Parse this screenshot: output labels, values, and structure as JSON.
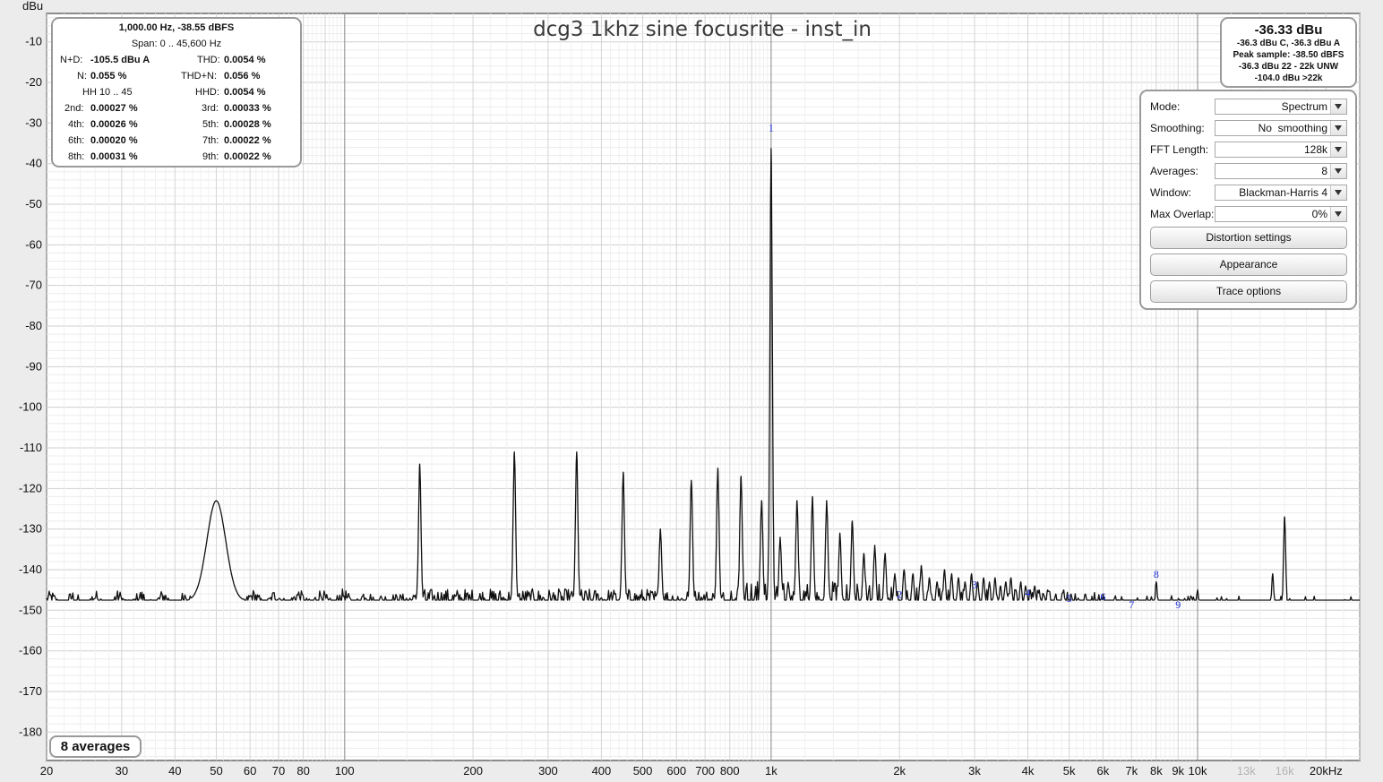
{
  "title": "dcg3 1khz sine focusrite - inst_in",
  "y_unit_label": "dBu",
  "stats": {
    "line1": "1,000.00 Hz, -38.55 dBFS",
    "line2": "Span: 0 .. 45,600 Hz",
    "nd_label": "N+D:",
    "nd_value": "-105.5 dBu A",
    "thd_label": "THD:",
    "thd_value": "0.0054 %",
    "n_label": "N:",
    "n_value": "0.055 %",
    "thdn_label": "THD+N:",
    "thdn_value": "0.056 %",
    "hh_text": "HH 10 .. 45",
    "hhd_label": "HHD:",
    "hhd_value": "0.0054 %",
    "h2_label": "2nd:",
    "h2_value": "0.00027 %",
    "h3_label": "3rd:",
    "h3_value": "0.00033 %",
    "h4_label": "4th:",
    "h4_value": "0.00026 %",
    "h5_label": "5th:",
    "h5_value": "0.00028 %",
    "h6_label": "6th:",
    "h6_value": "0.00020 %",
    "h7_label": "7th:",
    "h7_value": "0.00022 %",
    "h8_label": "8th:",
    "h8_value": "0.00031 %",
    "h9_label": "9th:",
    "h9_value": "0.00022 %"
  },
  "level": {
    "main": "-36.33 dBu",
    "line1": "-36.3 dBu C, -36.3 dBu A",
    "line2": "Peak sample: -38.50 dBFS",
    "line3": "-36.3 dBu 22 - 22k UNW",
    "line4": "-104.0 dBu >22k"
  },
  "settings": {
    "mode_label": "Mode:",
    "mode_value": "Spectrum",
    "smoothing_label": "Smoothing:",
    "smoothing_value": "No  smoothing",
    "fft_label": "FFT Length:",
    "fft_value": "128k",
    "averages_label": "Averages:",
    "averages_value": "8",
    "window_label": "Window:",
    "window_value": "Blackman-Harris 4",
    "overlap_label": "Max Overlap:",
    "overlap_value": "0%",
    "distortion_button": "Distortion settings",
    "appearance_button": "Appearance",
    "trace_button": "Trace options"
  },
  "averages_badge": "8 averages",
  "chart_data": {
    "type": "line",
    "title": "dcg3 1khz sine focusrite - inst_in",
    "ylabel": "dBu",
    "xlabel": "",
    "x_scale": "log",
    "xlim": [
      20,
      24000
    ],
    "ylim": [
      -187,
      -3
    ],
    "grid": true,
    "y_ticks": [
      -10,
      -20,
      -30,
      -40,
      -50,
      -60,
      -70,
      -80,
      -90,
      -100,
      -110,
      -120,
      -130,
      -140,
      -150,
      -160,
      -170,
      -180
    ],
    "x_ticks": [
      {
        "v": 20,
        "t": "20"
      },
      {
        "v": 30,
        "t": "30"
      },
      {
        "v": 40,
        "t": "40"
      },
      {
        "v": 50,
        "t": "50"
      },
      {
        "v": 60,
        "t": "60"
      },
      {
        "v": 70,
        "t": "70"
      },
      {
        "v": 80,
        "t": "80"
      },
      {
        "v": 100,
        "t": "100"
      },
      {
        "v": 200,
        "t": "200"
      },
      {
        "v": 300,
        "t": "300"
      },
      {
        "v": 400,
        "t": "400"
      },
      {
        "v": 500,
        "t": "500"
      },
      {
        "v": 600,
        "t": "600"
      },
      {
        "v": 700,
        "t": "700"
      },
      {
        "v": 800,
        "t": "800"
      },
      {
        "v": 1000,
        "t": "1k"
      },
      {
        "v": 2000,
        "t": "2k"
      },
      {
        "v": 3000,
        "t": "3k"
      },
      {
        "v": 4000,
        "t": "4k"
      },
      {
        "v": 5000,
        "t": "5k"
      },
      {
        "v": 6000,
        "t": "6k"
      },
      {
        "v": 7000,
        "t": "7k"
      },
      {
        "v": 8000,
        "t": "8k"
      },
      {
        "v": 9000,
        "t": "9k"
      },
      {
        "v": 10000,
        "t": "10k"
      },
      {
        "v": 13000,
        "t": "13k",
        "grey": true
      },
      {
        "v": 16000,
        "t": "16k",
        "grey": true
      },
      {
        "v": 20000,
        "t": "20kHz"
      }
    ],
    "noise_floor_profile": [
      {
        "f": 20,
        "db": -148
      },
      {
        "f": 100,
        "db": -147.5
      },
      {
        "f": 500,
        "db": -147.5
      },
      {
        "f": 1000,
        "db": -148
      },
      {
        "f": 2000,
        "db": -149
      },
      {
        "f": 5000,
        "db": -150.5
      },
      {
        "f": 10000,
        "db": -152
      },
      {
        "f": 20000,
        "db": -152
      },
      {
        "f": 24000,
        "db": -152
      }
    ],
    "peaks": [
      {
        "f": 50,
        "db": -123
      },
      {
        "f": 150,
        "db": -114
      },
      {
        "f": 250,
        "db": -111
      },
      {
        "f": 350,
        "db": -111
      },
      {
        "f": 450,
        "db": -116
      },
      {
        "f": 550,
        "db": -130
      },
      {
        "f": 650,
        "db": -118
      },
      {
        "f": 750,
        "db": -115
      },
      {
        "f": 850,
        "db": -117
      },
      {
        "f": 950,
        "db": -123
      },
      {
        "f": 1000,
        "db": -36.3
      },
      {
        "f": 1050,
        "db": -132
      },
      {
        "f": 1150,
        "db": -123
      },
      {
        "f": 1250,
        "db": -122
      },
      {
        "f": 1350,
        "db": -123
      },
      {
        "f": 1450,
        "db": -131
      },
      {
        "f": 1550,
        "db": -128
      },
      {
        "f": 1650,
        "db": -136
      },
      {
        "f": 1750,
        "db": -134
      },
      {
        "f": 1850,
        "db": -136
      },
      {
        "f": 1950,
        "db": -141
      },
      {
        "f": 2050,
        "db": -140
      },
      {
        "f": 2150,
        "db": -141
      },
      {
        "f": 2250,
        "db": -139
      },
      {
        "f": 2350,
        "db": -142
      },
      {
        "f": 2450,
        "db": -143
      },
      {
        "f": 2550,
        "db": -140
      },
      {
        "f": 2650,
        "db": -141
      },
      {
        "f": 2750,
        "db": -142
      },
      {
        "f": 2850,
        "db": -143
      },
      {
        "f": 2950,
        "db": -141
      },
      {
        "f": 3050,
        "db": -143
      },
      {
        "f": 3150,
        "db": -142
      },
      {
        "f": 3250,
        "db": -143
      },
      {
        "f": 3350,
        "db": -142
      },
      {
        "f": 3450,
        "db": -144
      },
      {
        "f": 3550,
        "db": -143
      },
      {
        "f": 3650,
        "db": -142
      },
      {
        "f": 3750,
        "db": -145
      },
      {
        "f": 3850,
        "db": -143
      },
      {
        "f": 3950,
        "db": -144
      },
      {
        "f": 4050,
        "db": -145
      },
      {
        "f": 4150,
        "db": -144
      },
      {
        "f": 4250,
        "db": -145
      },
      {
        "f": 4350,
        "db": -146
      },
      {
        "f": 4450,
        "db": -145
      },
      {
        "f": 4650,
        "db": -146
      },
      {
        "f": 4850,
        "db": -145
      },
      {
        "f": 5050,
        "db": -146
      },
      {
        "f": 5250,
        "db": -147
      },
      {
        "f": 5450,
        "db": -146
      },
      {
        "f": 5650,
        "db": -147
      },
      {
        "f": 5950,
        "db": -147
      },
      {
        "f": 8000,
        "db": -143
      },
      {
        "f": 10000,
        "db": -145
      },
      {
        "f": 15000,
        "db": -141
      },
      {
        "f": 16000,
        "db": -127
      }
    ],
    "harmonic_markers": [
      {
        "label": "1",
        "f": 1000,
        "db": -32
      },
      {
        "label": "2",
        "f": 2000,
        "db": -147
      },
      {
        "label": "3",
        "f": 3000,
        "db": -144.5
      },
      {
        "label": "4",
        "f": 4000,
        "db": -146.5
      },
      {
        "label": "5",
        "f": 5000,
        "db": -148
      },
      {
        "label": "6",
        "f": 6000,
        "db": -147.5
      },
      {
        "label": "7",
        "f": 7000,
        "db": -149.5
      },
      {
        "label": "8",
        "f": 8000,
        "db": -142
      },
      {
        "label": "9",
        "f": 9000,
        "db": -149.5
      }
    ]
  }
}
